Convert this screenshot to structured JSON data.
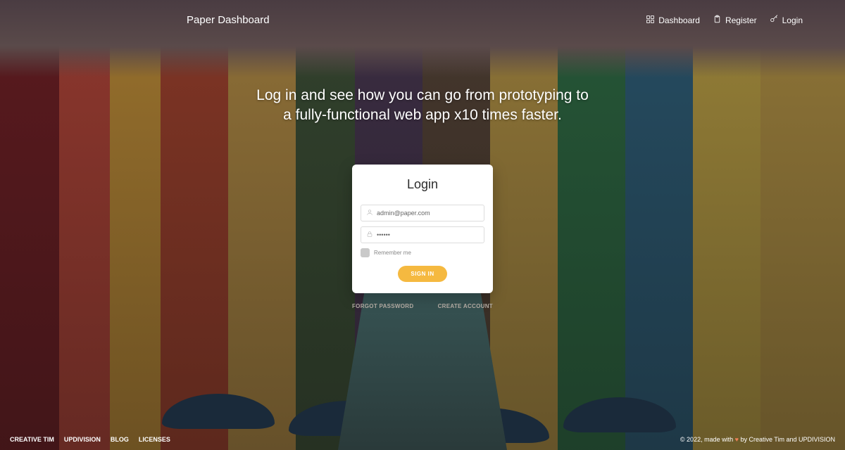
{
  "brand": "Paper Dashboard",
  "nav": {
    "dashboard": "Dashboard",
    "register": "Register",
    "login": "Login"
  },
  "hero": {
    "line1": "Log in and see how you can go from prototyping to",
    "line2": "a fully-functional web app x10 times faster."
  },
  "card": {
    "title": "Login",
    "email_value": "admin@paper.com",
    "password_masked": "••••••",
    "remember_label": "Remember me",
    "signin_label": "SIGN IN"
  },
  "below": {
    "forgot": "FORGOT PASSWORD",
    "create": "CREATE ACCOUNT"
  },
  "footer": {
    "links": {
      "creative_tim": "CREATIVE TIM",
      "updivision": "UPDIVISION",
      "blog": "BLOG",
      "licenses": "LICENSES"
    },
    "copyright_prefix": "© 2022, made with ",
    "copyright_suffix": " by Creative Tim and UPDIVISION"
  }
}
